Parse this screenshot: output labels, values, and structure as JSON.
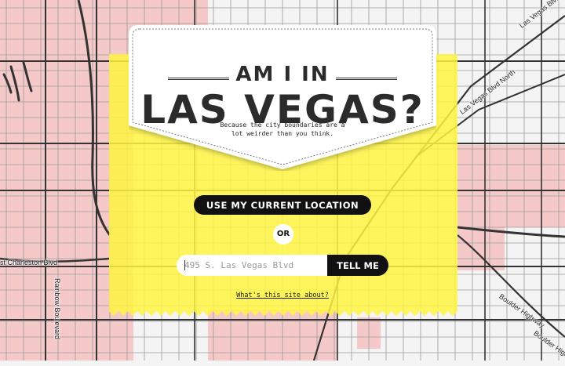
{
  "map": {
    "street_labels": {
      "charleston": "st Charleston Blvd",
      "rainbow": "Rainbow Boulevard",
      "lv_blvd_north": "Las Vegas Blvd North",
      "lv_blvd_north_2": "Las Vegas Blvd North",
      "boulder_hwy": "Boulder Highway",
      "boulder_hwy_2": "Boulder Highway"
    },
    "colors": {
      "city_fill": "#f6c9c9",
      "card_fill": "#fff442",
      "road": "#333333",
      "background": "#f4f4f4"
    }
  },
  "hero": {
    "heading_line1": "AM I IN",
    "heading_line2": "LAS VEGAS?",
    "tagline": "Because the city boundaries are a lot weirder than you think."
  },
  "actions": {
    "location_button": "USE MY CURRENT LOCATION",
    "or_label": "OR",
    "address_placeholder": "495 S. Las Vegas Blvd",
    "submit_button": "TELL ME",
    "about_link": "What's this site about?"
  }
}
